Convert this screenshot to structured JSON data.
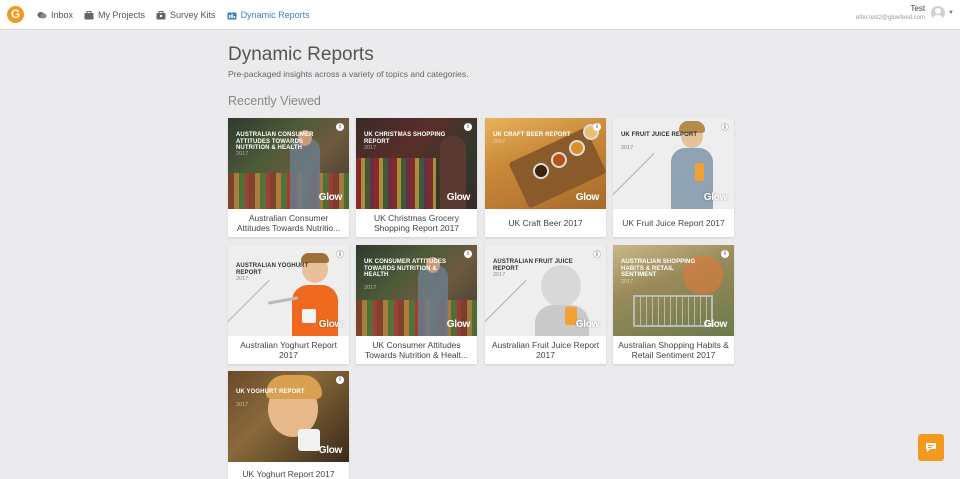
{
  "app": {
    "logo_letter": "G"
  },
  "nav": {
    "items": [
      {
        "label": "Inbox",
        "icon": "inbox-icon"
      },
      {
        "label": "My Projects",
        "icon": "briefcase-icon"
      },
      {
        "label": "Survey Kits",
        "icon": "kit-icon"
      },
      {
        "label": "Dynamic Reports",
        "icon": "reports-icon",
        "active": true
      }
    ]
  },
  "user": {
    "name": "Test",
    "email": "elfer.test2@glowfeed.com"
  },
  "page": {
    "title": "Dynamic Reports",
    "subtitle": "Pre-packaged insights across a variety of topics and categories.",
    "section_title": "Recently Viewed"
  },
  "info_glyph": "i",
  "brand_mark": "Glow",
  "reports": [
    {
      "label": "Australian Consumer Attitudes Towards Nutritio...",
      "thumb_title": "Australian Consumer Attitudes Towards Nutrition & Health",
      "thumb_year": "2017",
      "theme": "dark-market"
    },
    {
      "label": "UK Christmas Grocery Shopping Report 2017",
      "thumb_title": "UK Christmas Shopping Report",
      "thumb_year": "2017",
      "theme": "dark-red"
    },
    {
      "label": "UK Craft Beer 2017",
      "thumb_title": "UK Craft Beer Report",
      "thumb_year": "2017",
      "theme": "wood"
    },
    {
      "label": "UK Fruit Juice Report 2017",
      "thumb_title": "UK Fruit Juice Report",
      "thumb_year": "2017",
      "theme": "light-kid"
    },
    {
      "label": "Australian Yoghurt Report 2017",
      "thumb_title": "Australian Yoghurt Report",
      "thumb_year": "2017",
      "theme": "light-boy"
    },
    {
      "label": "UK Consumer Attitudes Towards Nutrition & Healt...",
      "thumb_title": "UK Consumer Attitudes Towards Nutrition & Health",
      "thumb_year": "2017",
      "theme": "dark-market"
    },
    {
      "label": "Australian Fruit Juice Report 2017",
      "thumb_title": "Australian Fruit Juice Report",
      "thumb_year": "2017",
      "theme": "light-girl"
    },
    {
      "label": "Australian Shopping Habits & Retail Sentiment 2017",
      "thumb_title": "Australian Shopping Habits & Retail Sentiment",
      "thumb_year": "2017",
      "theme": "cart"
    },
    {
      "label": "UK Yoghurt Report 2017",
      "thumb_title": "UK Yoghurt Report",
      "thumb_year": "2017",
      "theme": "kid-eating"
    }
  ],
  "colors": {
    "accent": "#3b7fc4",
    "brand": "#f39a1e",
    "background": "#ebebee"
  }
}
